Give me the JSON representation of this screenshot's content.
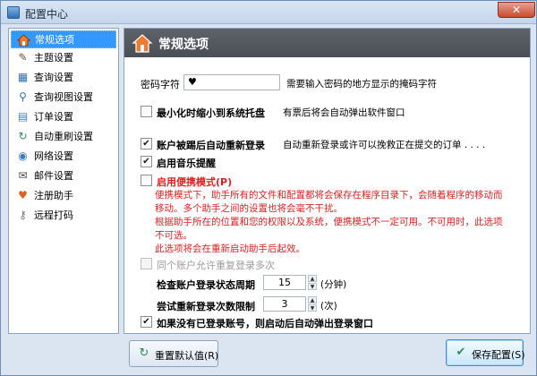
{
  "window": {
    "title": "配置中心",
    "close_glyph": "✕"
  },
  "sidebar": {
    "items": [
      {
        "label": "常规选项",
        "icon": "home-icon",
        "glyph": "⌂",
        "color": "#d2691e"
      },
      {
        "label": "主题设置",
        "icon": "paintbrush-icon",
        "glyph": "✎",
        "color": "#6b4b2a"
      },
      {
        "label": "查询设置",
        "icon": "grid-icon",
        "glyph": "▦",
        "color": "#2f6fb3"
      },
      {
        "label": "查询视图设置",
        "icon": "magnifier-icon",
        "glyph": "⚲",
        "color": "#2f6fb3"
      },
      {
        "label": "订单设置",
        "icon": "order-icon",
        "glyph": "▤",
        "color": "#3a7bd5"
      },
      {
        "label": "自动重刷设置",
        "icon": "refresh-icon",
        "glyph": "↻",
        "color": "#2e8b57"
      },
      {
        "label": "网络设置",
        "icon": "network-icon",
        "glyph": "◉",
        "color": "#3b78c4"
      },
      {
        "label": "邮件设置",
        "icon": "mail-icon",
        "glyph": "✉",
        "color": "#4a4a4a"
      },
      {
        "label": "注册助手",
        "icon": "heart-icon",
        "glyph": "♥",
        "color": "#e06020"
      },
      {
        "label": "远程打码",
        "icon": "key-icon",
        "glyph": "⚷",
        "color": "#777777"
      }
    ]
  },
  "header": {
    "title": "常规选项"
  },
  "settings": {
    "password_char_label": "密码字符",
    "password_char_value": "♥",
    "password_char_hint": "需要输入密码的地方显示的掩码字符",
    "minimize_tray_label": "最小化时缩小到系统托盘",
    "minimize_tray_checked": false,
    "minimize_tray_hint": "有票后将会自动弹出软件窗口",
    "auto_relogin_label": "账户被踢后自动重新登录",
    "auto_relogin_checked": true,
    "auto_relogin_hint": "自动重新登录或许可以挽救正在提交的订单 . . . .",
    "music_label": "启用音乐提醒",
    "music_checked": true,
    "portable_label": "启用便携模式(P)",
    "portable_checked": false,
    "portable_warn_lines": [
      "便携模式下，助手所有的文件和配置都将会保存在程序目录下，会随着程序的移动而",
      "移动。多个助手之间的设置也将会毫不干扰。",
      "根据助手所在的位置和您的权限以及系统，便携模式不一定可用。不可用时，此选项",
      "不可选。",
      "此选项将会在重新启动助手后起效。"
    ],
    "multi_login_label": "同个账户允许重复登录多次",
    "multi_login_checked": false,
    "check_period_label": "检查账户登录状态周期",
    "check_period_value": "15",
    "check_period_unit": "(分钟)",
    "retry_label": "尝试重新登录次数限制",
    "retry_value": "3",
    "retry_unit": "(次)",
    "auto_popup_label": "如果没有已登录账号，则启动后自动弹出登录窗口",
    "auto_popup_checked": true
  },
  "buttons": {
    "reset_label": "重置默认值(R)",
    "save_label": "保存配置(S)"
  },
  "colors": {
    "accent": "#3399ff",
    "warning": "#e02020",
    "header_bg": "#52575d"
  }
}
